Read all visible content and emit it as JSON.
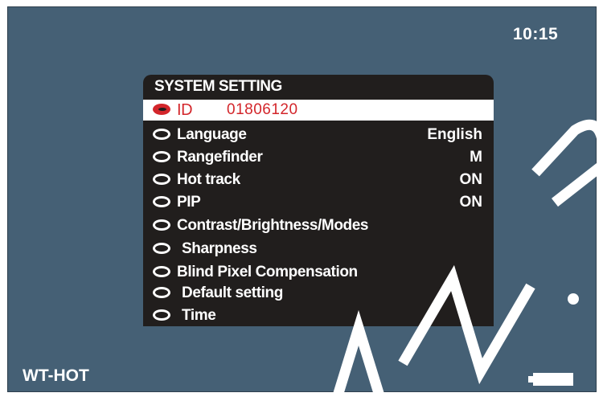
{
  "status": {
    "clock": "10:15",
    "mode": "WT-HOT",
    "battery_level": 1.0
  },
  "menu": {
    "title": "SYSTEM SETTING",
    "id_label": "ID",
    "id_value": "01806120",
    "items": [
      {
        "label": "Language",
        "value": "English"
      },
      {
        "label": "Rangefinder",
        "value": "M"
      },
      {
        "label": "Hot track",
        "value": "ON"
      },
      {
        "label": "PIP",
        "value": "ON"
      },
      {
        "label": "Contrast/Brightness/Modes",
        "value": ""
      },
      {
        "label": "Sharpness",
        "value": ""
      },
      {
        "label": "Blind Pixel Compensation",
        "value": ""
      },
      {
        "label": "Default setting",
        "value": ""
      },
      {
        "label": "Time",
        "value": ""
      }
    ]
  },
  "watermark": {
    "text": "AN.R",
    "color": "#ffffff"
  },
  "colors": {
    "screen": "#456075",
    "menu": "#211e1d",
    "selected": "#ffffff",
    "accent": "#d3262b"
  },
  "icons": {
    "menu_item": "radio-icon",
    "power": "battery-icon"
  }
}
